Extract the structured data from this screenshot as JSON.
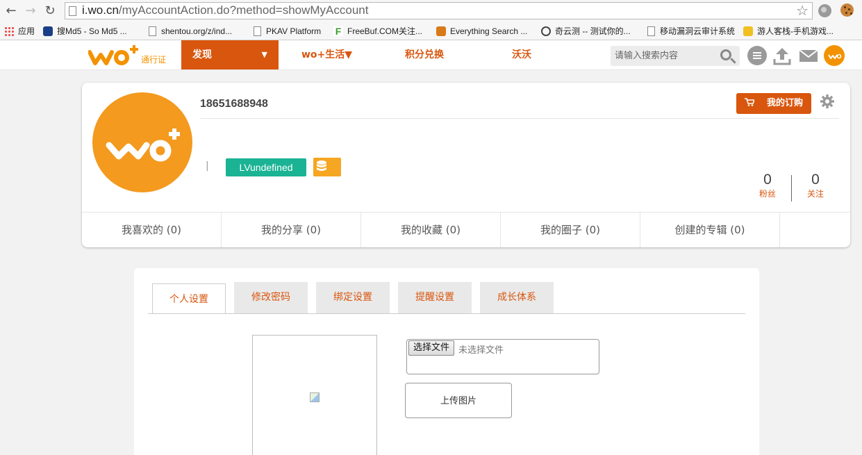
{
  "browser": {
    "url_host": "i.wo.cn",
    "url_path": "/myAccountAction.do?method=showMyAccount",
    "bookmarks": [
      {
        "label": "应用",
        "icon": "apps-grid-icon"
      },
      {
        "label": "搜Md5 - So Md5 ...",
        "icon": "md5-site-icon"
      },
      {
        "label": "shentou.org/z/ind...",
        "icon": "page-icon"
      },
      {
        "label": "PKAV Platform",
        "icon": "page-icon"
      },
      {
        "label": "FreeBuf.COM关注...",
        "icon": "freebuf-icon"
      },
      {
        "label": "Everything Search ...",
        "icon": "everything-search-icon"
      },
      {
        "label": "奇云测 -- 测试你的...",
        "icon": "qiyunce-icon"
      },
      {
        "label": "移动漏洞云审计系统",
        "icon": "page-icon"
      },
      {
        "label": "游人客栈-手机游戏...",
        "icon": "game-site-icon"
      }
    ]
  },
  "header": {
    "logo_sub": "通行证",
    "nav": {
      "discover": "发现",
      "discover_caret": "▼",
      "life": "wo+生活▼",
      "points": "积分兑换",
      "wowo": "沃沃"
    },
    "search_placeholder": "请输入搜索内容"
  },
  "profile": {
    "username": "18651688948",
    "separator": "|",
    "level": "LVundefined",
    "order_button": "我的订购",
    "fans_count": "0",
    "fans_label": "粉丝",
    "follow_count": "0",
    "follow_label": "关注",
    "tabs": [
      {
        "label": "我喜欢的  (0)"
      },
      {
        "label": "我的分享 (0)"
      },
      {
        "label": "我的收藏  (0)"
      },
      {
        "label": "我的圈子 (0)"
      },
      {
        "label": "创建的专辑  (0)"
      }
    ]
  },
  "settings": {
    "tabs": [
      {
        "label": "个人设置"
      },
      {
        "label": "修改密码"
      },
      {
        "label": "绑定设置"
      },
      {
        "label": "提醒设置"
      },
      {
        "label": "成长体系"
      }
    ],
    "file_button": "选择文件",
    "file_status": "未选择文件",
    "upload_button": "上传图片"
  },
  "colors": {
    "brand_orange": "#f39200",
    "nav_active": "#d9560e",
    "level_green": "#1ab394",
    "coin_yellow": "#f5a623"
  }
}
